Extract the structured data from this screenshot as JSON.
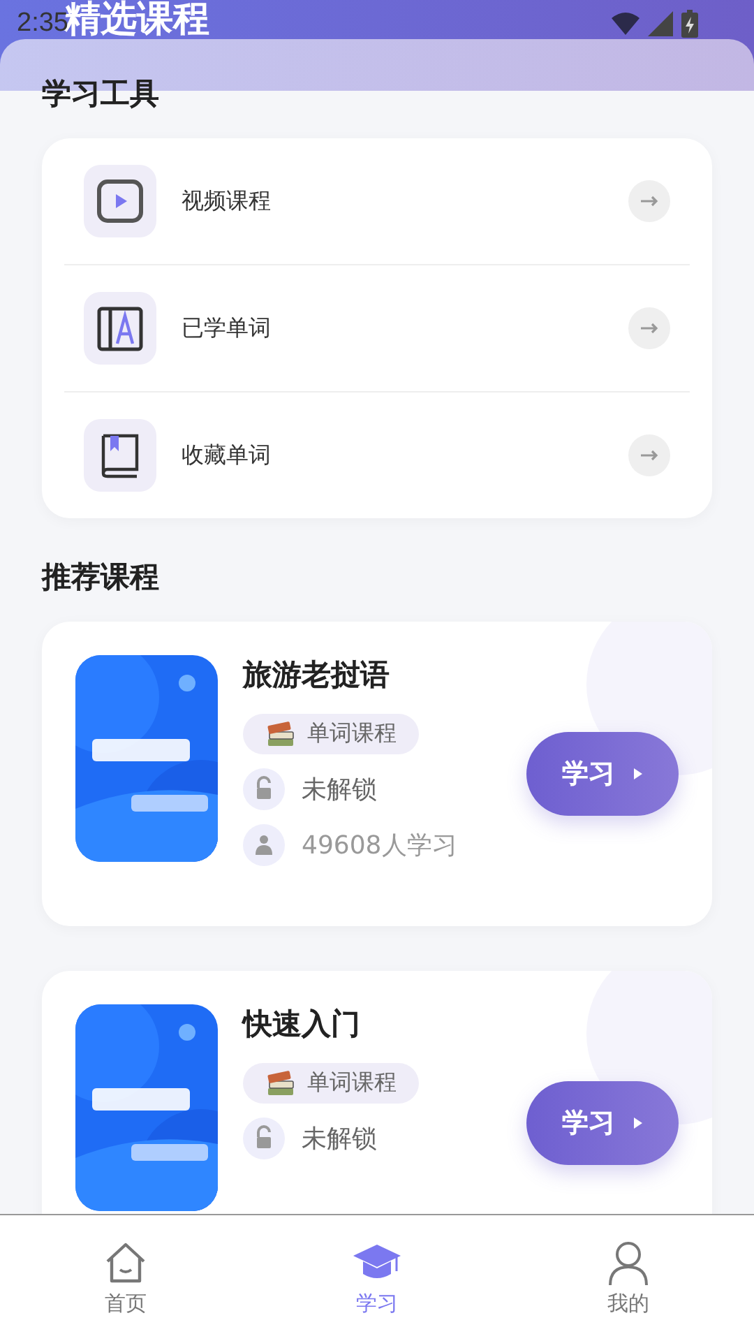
{
  "status_bar": {
    "time": "2:35"
  },
  "header": {
    "title": "精选课程"
  },
  "tools": {
    "title": "学习工具",
    "items": [
      {
        "kind": "video",
        "label": "视频课程"
      },
      {
        "kind": "learned",
        "label": "已学单词"
      },
      {
        "kind": "favorite",
        "label": "收藏单词"
      }
    ]
  },
  "recommended": {
    "title": "推荐课程",
    "courses": [
      {
        "title": "旅游老挝语",
        "tag": "单词课程",
        "lock": "未解锁",
        "learners": "49608人学习",
        "button": "学习"
      },
      {
        "title": "快速入门",
        "tag": "单词课程",
        "lock": "未解锁",
        "button": "学习"
      }
    ]
  },
  "tab_bar": [
    {
      "kind": "home",
      "label": "首页",
      "selected": false
    },
    {
      "kind": "study",
      "label": "学习",
      "selected": true
    },
    {
      "kind": "me",
      "label": "我的",
      "selected": false
    }
  ]
}
